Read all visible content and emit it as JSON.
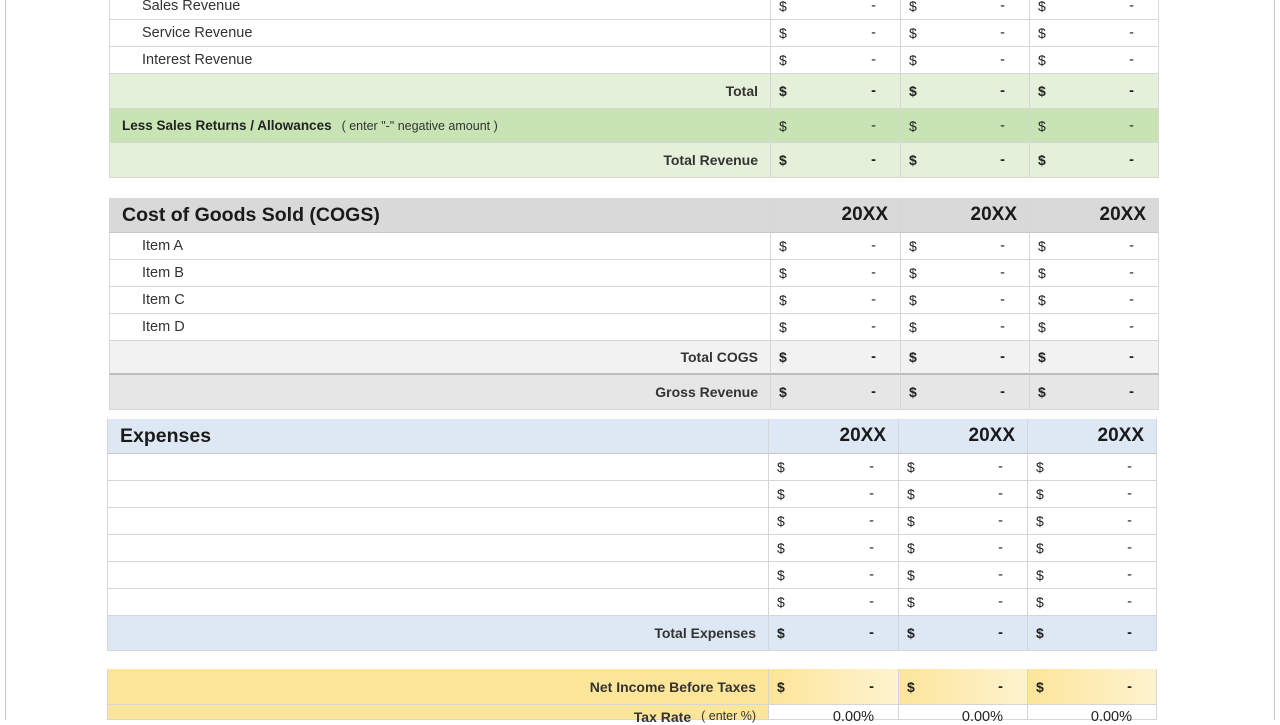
{
  "revenue": {
    "items": [
      {
        "label": "Sales Revenue",
        "values": [
          "-",
          "-",
          "-"
        ]
      },
      {
        "label": "Service Revenue",
        "values": [
          "-",
          "-",
          "-"
        ]
      },
      {
        "label": "Interest Revenue",
        "values": [
          "-",
          "-",
          "-"
        ]
      }
    ],
    "total_label": "Total",
    "total_values": [
      "-",
      "-",
      "-"
    ],
    "returns_label": "Less Sales Returns / Allowances",
    "returns_note": "( enter \"-\" negative amount )",
    "returns_values": [
      "-",
      "-",
      "-"
    ],
    "total_revenue_label": "Total Revenue",
    "total_revenue_values": [
      "-",
      "-",
      "-"
    ]
  },
  "cogs": {
    "title": "Cost of Goods Sold (COGS)",
    "years": [
      "20XX",
      "20XX",
      "20XX"
    ],
    "items": [
      {
        "label": "Item A",
        "values": [
          "-",
          "-",
          "-"
        ]
      },
      {
        "label": "Item B",
        "values": [
          "-",
          "-",
          "-"
        ]
      },
      {
        "label": "Item C",
        "values": [
          "-",
          "-",
          "-"
        ]
      },
      {
        "label": "Item D",
        "values": [
          "-",
          "-",
          "-"
        ]
      }
    ],
    "total_label": "Total COGS",
    "total_values": [
      "-",
      "-",
      "-"
    ],
    "gross_label": "Gross Revenue",
    "gross_values": [
      "-",
      "-",
      "-"
    ]
  },
  "expenses": {
    "title": "Expenses",
    "years": [
      "20XX",
      "20XX",
      "20XX"
    ],
    "rows": [
      {
        "label": "",
        "values": [
          "-",
          "-",
          "-"
        ]
      },
      {
        "label": "",
        "values": [
          "-",
          "-",
          "-"
        ]
      },
      {
        "label": "",
        "values": [
          "-",
          "-",
          "-"
        ]
      },
      {
        "label": "",
        "values": [
          "-",
          "-",
          "-"
        ]
      },
      {
        "label": "",
        "values": [
          "-",
          "-",
          "-"
        ]
      },
      {
        "label": "",
        "values": [
          "-",
          "-",
          "-"
        ]
      }
    ],
    "total_label": "Total Expenses",
    "total_values": [
      "-",
      "-",
      "-"
    ]
  },
  "net": {
    "label": "Net Income Before Taxes",
    "values": [
      "-",
      "-",
      "-"
    ],
    "tax_label": "Tax Rate",
    "tax_note": "( enter %)",
    "tax_values": [
      "0.00%",
      "0.00%",
      "0.00%"
    ]
  },
  "currency_symbol": "$"
}
